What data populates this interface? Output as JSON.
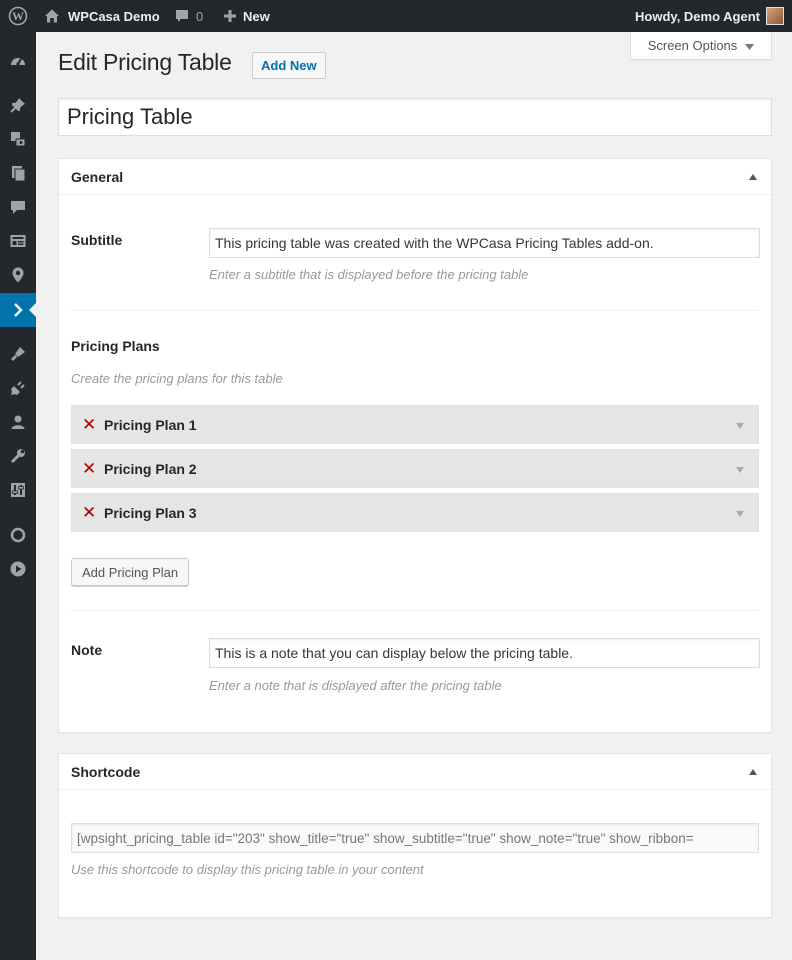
{
  "adminbar": {
    "site_name": "WPCasa Demo",
    "comments_count": "0",
    "new_label": "New",
    "account_greeting": "Howdy, Demo Agent"
  },
  "sidebar": {
    "icons": [
      "dashboard-icon",
      "pin-icon",
      "media-icon",
      "pages-icon",
      "comments-icon",
      "listings-icon",
      "location-icon",
      "current-plugin-icon",
      "appearance-icon",
      "plugins-icon",
      "users-icon",
      "tools-icon",
      "settings-icon",
      "circle-icon",
      "play-icon"
    ],
    "current_index": 7,
    "accent": "#0073aa"
  },
  "screen_options": {
    "label": "Screen Options"
  },
  "page": {
    "title": "Edit Pricing Table",
    "add_new_label": "Add New",
    "post_title_value": "Pricing Table"
  },
  "general_box": {
    "heading": "General",
    "subtitle": {
      "label": "Subtitle",
      "value": "This pricing table was created with the WPCasa Pricing Tables add-on.",
      "description": "Enter a subtitle that is displayed before the pricing table"
    },
    "plans": {
      "label": "Pricing Plans",
      "description": "Create the pricing plans for this table",
      "items": [
        {
          "remove_glyph": "✕",
          "title": "Pricing Plan 1"
        },
        {
          "remove_glyph": "✕",
          "title": "Pricing Plan 2"
        },
        {
          "remove_glyph": "✕",
          "title": "Pricing Plan 3"
        }
      ],
      "add_button_label": "Add Pricing Plan"
    },
    "note": {
      "label": "Note",
      "value": "This is a note that you can display below the pricing table.",
      "description": "Enter a note that is displayed after the pricing table"
    }
  },
  "shortcode_box": {
    "heading": "Shortcode",
    "value": "[wpsight_pricing_table id=\"203\" show_title=\"true\" show_subtitle=\"true\" show_note=\"true\" show_ribbon=",
    "description": "Use this shortcode to display this pricing table in your content"
  }
}
